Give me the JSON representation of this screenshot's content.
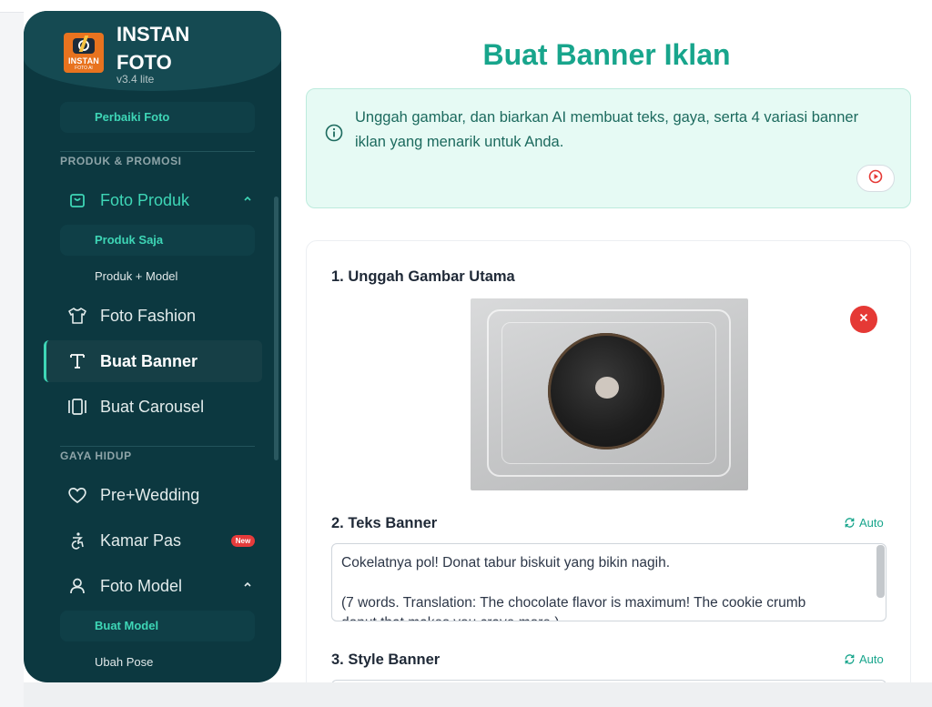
{
  "brand": {
    "line1": "INSTAN",
    "line2": "FOTO",
    "version": "v3.4 lite",
    "logo_line1": "INSTAN",
    "logo_line2": "FOTO AI"
  },
  "sidebar": {
    "top_item": "Perbaiki Foto",
    "section1": "PRODUK & PROMOSI",
    "section2": "GAYA HIDUP",
    "foto_produk": "Foto Produk",
    "produk_saja": "Produk Saja",
    "produk_model": "Produk + Model",
    "foto_fashion": "Foto Fashion",
    "buat_banner": "Buat Banner",
    "buat_carousel": "Buat Carousel",
    "pre_wedding": "Pre+Wedding",
    "kamar_pas": "Kamar Pas",
    "new_badge": "New",
    "foto_model": "Foto Model",
    "buat_model": "Buat Model",
    "ubah_pose": "Ubah Pose"
  },
  "main": {
    "title": "Buat Banner Iklan",
    "info_text": "Unggah gambar, dan biarkan AI membuat teks, gaya, serta 4 variasi banner iklan yang menarik untuk Anda.",
    "step1": "1. Unggah Gambar Utama",
    "step2": "2. Teks Banner",
    "step3": "3. Style Banner",
    "auto_label": "Auto",
    "banner_text_line1": "Cokelatnya pol! Donat tabur biskuit yang bikin nagih.",
    "banner_text_line2": "(7 words. Translation: The chocolate flavor is maximum! The cookie crumb",
    "banner_text_line3": "donut that makes you crave more.)"
  },
  "colors": {
    "accent": "#18a58c",
    "sidebar_bg": "#0c3840",
    "danger": "#e53935"
  }
}
